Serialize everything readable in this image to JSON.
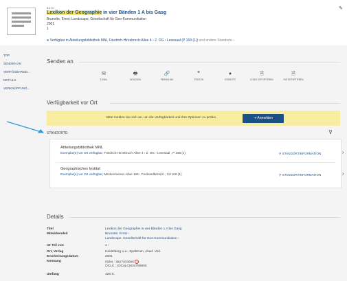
{
  "record": {
    "type_label": "BUCH",
    "title_highlight": "Lexikon der Geographie",
    "title_rest": " in vier Bänden 1 A bis Gasg",
    "authors": "Brunotte, Ernst; Landscape, Gesellschaft für Geo-Kommunikation",
    "year": "2001",
    "volume": "1",
    "availability_prefix": "Verfügbar in Abteilungsbibliothek MNL",
    "availability_location": "Friedrich-Hirzebruch-Allee 4 › 2. OG › Lesesaal (P 168 (1))",
    "availability_more": "und andere Standorte",
    "availability_chevron": "›"
  },
  "sidebar": {
    "items": [
      {
        "label": "TOP"
      },
      {
        "label": "SENDEN AN"
      },
      {
        "label": "VERFÜGBARKEI..."
      },
      {
        "label": "DETAILS"
      },
      {
        "label": "VERKNÜPFUNG..."
      }
    ]
  },
  "senden": {
    "heading": "Senden an",
    "actions": [
      {
        "label": "E-MAIL",
        "icon": "✉",
        "name": "email"
      },
      {
        "label": "DRUCKEN",
        "icon": "🖶",
        "name": "print"
      },
      {
        "label": "PERMALINK",
        "icon": "🔗",
        "name": "permalink"
      },
      {
        "label": "ZITATION",
        "icon": "❞",
        "name": "citation"
      },
      {
        "label": "ENDNOTE",
        "icon": "●",
        "name": "endnote"
      },
      {
        "label": "CITAVI EXPORTIEREN",
        "icon": "🗎",
        "name": "citavi"
      },
      {
        "label": "RIS EXPORTIEREN",
        "icon": "🗎",
        "name": "ris"
      }
    ]
  },
  "availability": {
    "heading": "Verfügbarkeit vor Ort",
    "login_message": "Bitte melden Sie sich an, um die Verfügbarkeit und Ihre Optionen zu prüfen.",
    "login_button": "Anmelden",
    "locations_label": "STANDORTE:",
    "locations": [
      {
        "name": "Abteilungsbibliothek MNL",
        "status": "Exemplar(e) vor Ort verfügbar",
        "details": ", Friedrich-Hirzebruch-Allee 4 › 2. OG › Lesesaal , P 168 (1)",
        "info": "STANDORTINFORMATION",
        "chevron": "›"
      },
      {
        "name": "Geographisches Institut",
        "status": "Exemplar(e) vor Ort verfügbar",
        "details": ", Meckenheimer Allee 166 › Freihandbereich , Cd 106 (1)",
        "info": "STANDORTINFORMATION",
        "chevron": "›"
      }
    ]
  },
  "details": {
    "heading": "Details",
    "rows": [
      {
        "label": "Titel",
        "values": [
          "Lexikon der Geographie in vier Bänden 1 A bis Gasg"
        ]
      },
      {
        "label": "Mitwirkende/r",
        "values": [
          "Brunotte, Ernst  ›",
          "Landscape, Gesellschaft für Geo-Kommunikation  ›"
        ]
      },
      {
        "label": "Ist Teil von",
        "values": [
          "1  ›"
        ]
      },
      {
        "label": "Ort, Verlag",
        "values": [
          "Heidelberg u.a., Spektrum, Akad. Verl."
        ]
      },
      {
        "label": "Erscheinungsdatum",
        "values": [
          "2001"
        ]
      },
      {
        "label": "Kennung",
        "values": [
          "ISBN : 3827403006",
          "OCLC : (OCoLC)634788600"
        ]
      },
      {
        "label": "Umfang",
        "values": [
          "426 S."
        ]
      }
    ],
    "isbn_badge": "?"
  },
  "colors": {
    "link": "#1a4f8b",
    "highlight": "#f7e86a",
    "banner": "#f8eca0",
    "button": "#1c4f84",
    "arrow": "#2a9bd8"
  },
  "icons": {
    "bookmark": "pin-icon",
    "filter": "filter-icon",
    "login": "login-icon",
    "location": "location-pin-icon"
  }
}
